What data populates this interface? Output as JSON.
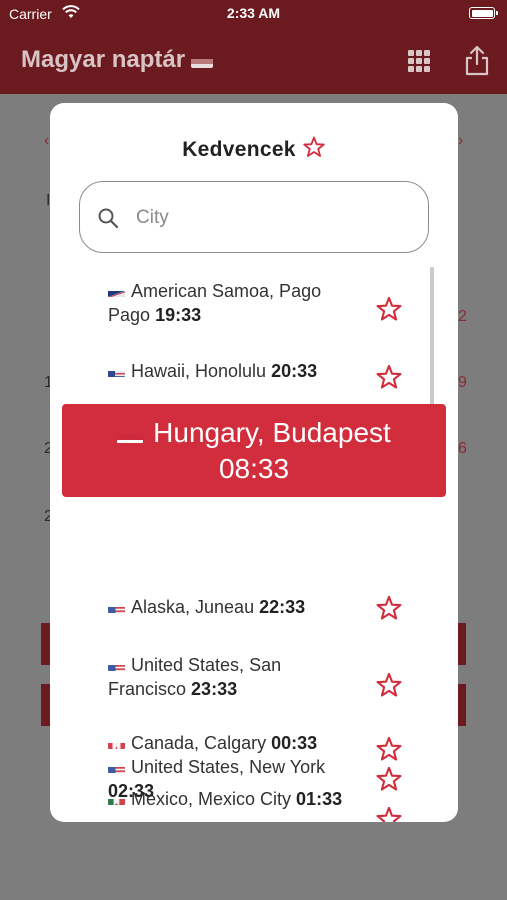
{
  "status_bar": {
    "carrier": "Carrier",
    "time": "2:33 AM"
  },
  "nav": {
    "title": "Magyar naptár",
    "grid_icon": "grid-icon",
    "share_icon": "share-icon"
  },
  "modal": {
    "title": "Kedvencek",
    "search": {
      "placeholder": "City",
      "value": ""
    },
    "items": [
      {
        "flag": "american-samoa",
        "place": "American Samoa, Pago Pago",
        "time": "19:33"
      },
      {
        "flag": "united-states",
        "place": "Hawaii, Honolulu",
        "time": "20:33"
      },
      {
        "flag": "united-states",
        "place": "Alaska, Juneau",
        "time": "22:33"
      },
      {
        "flag": "united-states",
        "place": "United States, San Francisco",
        "time": "23:33"
      },
      {
        "flag": "canada",
        "place": "Canada, Calgary",
        "time": "00:33"
      },
      {
        "flag": "mexico",
        "place": "Mexico, Mexico City",
        "time": "01:33"
      },
      {
        "flag": "united-states",
        "place": "United States, New York",
        "time": "02:33"
      }
    ]
  },
  "toast": {
    "flag": "hungary",
    "place": "Hungary, Budapest",
    "time": "08:33"
  },
  "colors": {
    "accent": "#d22d3d",
    "nav_background": "#6b1a20",
    "star": "#d22d3d"
  }
}
